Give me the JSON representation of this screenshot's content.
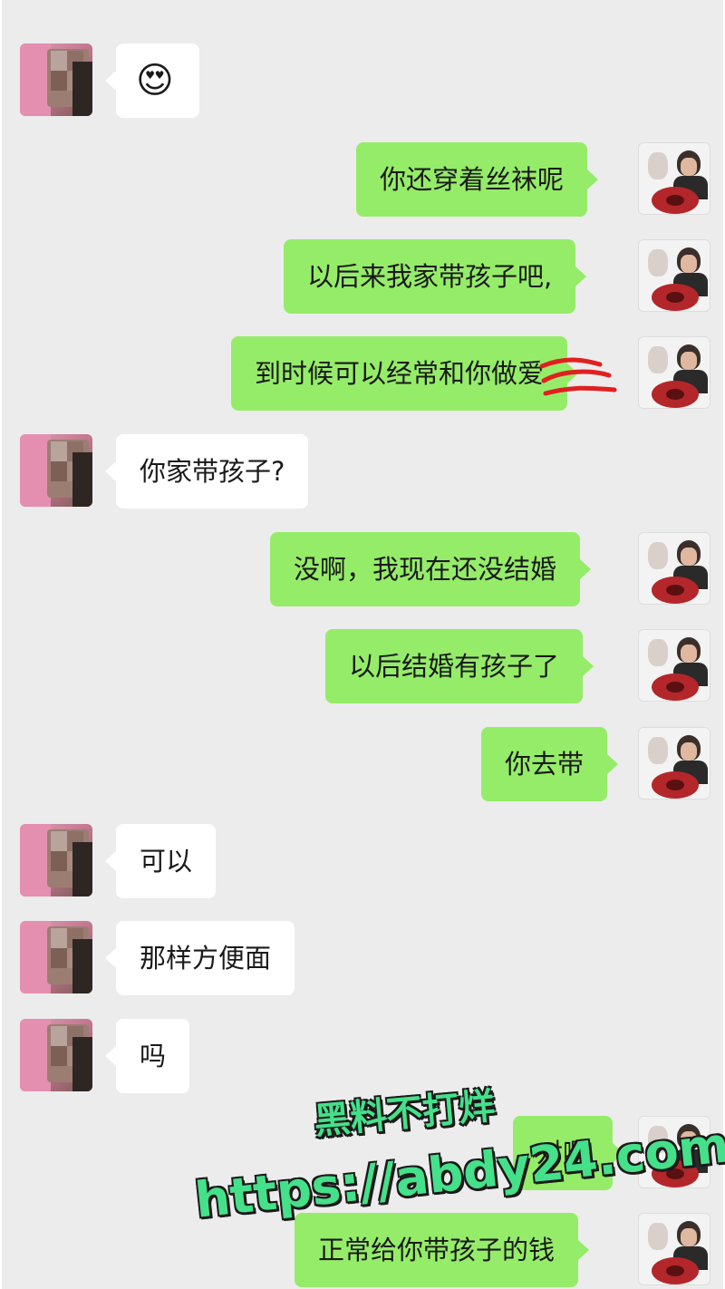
{
  "chat": {
    "messages": [
      {
        "sender": "her",
        "text": "😍",
        "kind": "emoji"
      },
      {
        "sender": "me",
        "text": "你还穿着丝袜呢"
      },
      {
        "sender": "me",
        "text": "以后来我家带孩子吧,"
      },
      {
        "sender": "me",
        "text": "到时候可以经常和你做爱",
        "annotation": "red scribble over last two characters"
      },
      {
        "sender": "her",
        "text": "你家带孩子?"
      },
      {
        "sender": "me",
        "text": "没啊，我现在还没结婚"
      },
      {
        "sender": "me",
        "text": "以后结婚有孩子了"
      },
      {
        "sender": "me",
        "text": "你去带"
      },
      {
        "sender": "her",
        "text": "可以"
      },
      {
        "sender": "her",
        "text": "那样方便面"
      },
      {
        "sender": "her",
        "text": "吗"
      },
      {
        "sender": "me",
        "text": "对啊"
      },
      {
        "sender": "me",
        "text": "正常给你带孩子的钱"
      }
    ]
  },
  "watermark": {
    "line1": "黑料不打烊",
    "line2": "https://abdy24.com"
  },
  "colors": {
    "background": "#ececec",
    "my_bubble": "#95ec69",
    "her_bubble": "#ffffff",
    "scribble": "#e02020",
    "watermark": "#45e08a"
  }
}
